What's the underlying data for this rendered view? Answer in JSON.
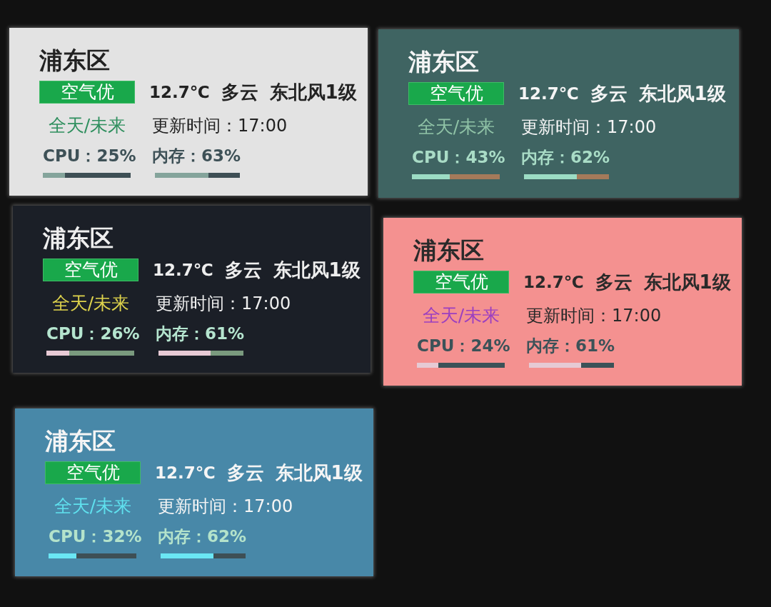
{
  "widgets": [
    {
      "kind": "light",
      "color": "#e3e3e3",
      "title": "浦东区",
      "badge": "空气优",
      "temperature": "12.7℃",
      "condition": "多云",
      "wind": "东北风1级",
      "forecast_link": {
        "text": "全天/未来",
        "color": "#2f8f5e"
      },
      "updated": "更新时间：17:00",
      "cpu": {
        "label": "CPU：25%",
        "level": 0.25,
        "color": "#84a49b"
      },
      "memory": {
        "label": "内存：63%",
        "level": 0.63,
        "color": "#84a49b"
      }
    },
    {
      "kind": "teal",
      "color": "#3f6462",
      "title": "浦东区",
      "badge": "空气优",
      "temperature": "12.7℃",
      "condition": "多云",
      "wind": "东北风1级",
      "forecast_link": {
        "text": "全天/未来",
        "color": "#8fc2a6"
      },
      "updated": "更新时间：17:00",
      "cpu": {
        "label": "CPU：43%",
        "level": 0.43,
        "color": "#9cdcc4"
      },
      "memory": {
        "label": "内存：62%",
        "level": 0.62,
        "color": "#9cdcc4"
      }
    },
    {
      "kind": "dark",
      "color": "#1b1f27",
      "title": "浦东区",
      "badge": "空气优",
      "temperature": "12.7℃",
      "condition": "多云",
      "wind": "东北风1级",
      "forecast_link": {
        "text": "全天/未来",
        "color": "#ddd24c"
      },
      "updated": "更新时间：17:00",
      "cpu": {
        "label": "CPU：26%",
        "level": 0.26,
        "color": "#e8cad5"
      },
      "memory": {
        "label": "内存：61%",
        "level": 0.61,
        "color": "#e8cad5"
      }
    },
    {
      "kind": "coral",
      "color": "#f49190",
      "title": "浦东区",
      "badge": "空气优",
      "temperature": "12.7℃",
      "condition": "多云",
      "wind": "东北风1级",
      "forecast_link": {
        "text": "全天/未来",
        "color": "#9b3fc0"
      },
      "updated": "更新时间：17:00",
      "cpu": {
        "label": "CPU：24%",
        "level": 0.24,
        "color": "#e6cad4"
      },
      "memory": {
        "label": "内存：61%",
        "level": 0.61,
        "color": "#e6cad4"
      }
    },
    {
      "kind": "steel",
      "color": "#4888a8",
      "title": "浦东区",
      "badge": "空气优",
      "temperature": "12.7℃",
      "condition": "多云",
      "wind": "东北风1级",
      "forecast_link": {
        "text": "全天/未来",
        "color": "#5fe0ee"
      },
      "updated": "更新时间：17:00",
      "cpu": {
        "label": "CPU：32%",
        "level": 0.32,
        "color": "#6ae6f4"
      },
      "memory": {
        "label": "内存：62%",
        "level": 0.62,
        "color": "#6ae6f4"
      }
    }
  ]
}
